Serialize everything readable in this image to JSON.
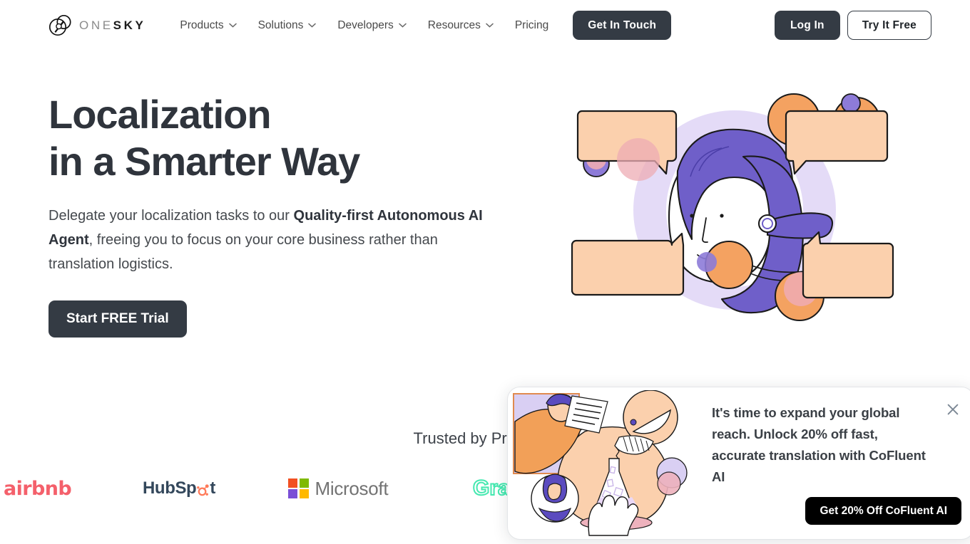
{
  "header": {
    "logo": {
      "icon": "onesky-logo-icon",
      "text_light": "ONE",
      "text_bold": "SKY"
    },
    "nav": [
      {
        "label": "Products",
        "has_chevron": true
      },
      {
        "label": "Solutions",
        "has_chevron": true
      },
      {
        "label": "Developers",
        "has_chevron": true
      },
      {
        "label": "Resources",
        "has_chevron": true
      },
      {
        "label": "Pricing",
        "has_chevron": false
      }
    ],
    "get_in_touch_label": "Get In Touch",
    "login_label": "Log In",
    "try_free_label": "Try It Free"
  },
  "hero": {
    "title_line1": "Localization",
    "title_line2": "in a Smarter Way",
    "sub_part1": "Delegate your localization tasks to our ",
    "sub_bold": "Quality-first Autonomous AI Agent",
    "sub_part2": ", freeing you to focus on your core business rather than translation logistics.",
    "cta_label": "Start FREE Trial",
    "illustration": "person-with-speech-bubbles-illustration"
  },
  "trusted": {
    "heading": "Trusted by Professio",
    "logos": [
      {
        "name": "airbnb",
        "label": "airbnb",
        "color": "#f4606b"
      },
      {
        "name": "hubspot",
        "label_a": "HubSp",
        "label_b": "t",
        "color": "#33475b",
        "accent": "#ff7a59"
      },
      {
        "name": "microsoft",
        "label": "Microsoft",
        "color": "#737373",
        "squares": [
          "#f25022",
          "#7fba00",
          "#7a4fd6",
          "#ffb900"
        ]
      },
      {
        "name": "grab",
        "label": "Gra",
        "color": "#45e8b0"
      }
    ]
  },
  "popup": {
    "illustration": "scientist-pouring-flask-illustration",
    "message": "It's time to expand your global reach. Unlock 20% off fast, accurate translation with CoFluent AI",
    "cta_label": "Get 20% Off CoFluent AI",
    "close_icon": "close-icon"
  },
  "colors": {
    "dark_button": "#343b44",
    "black_button": "#000000",
    "heading": "#2f343c",
    "body_text": "#45494e",
    "art_purple": "#6f5fc9",
    "art_lavender": "#d9cff3",
    "art_peach": "#fbd0ad",
    "art_orange": "#f4a261"
  }
}
